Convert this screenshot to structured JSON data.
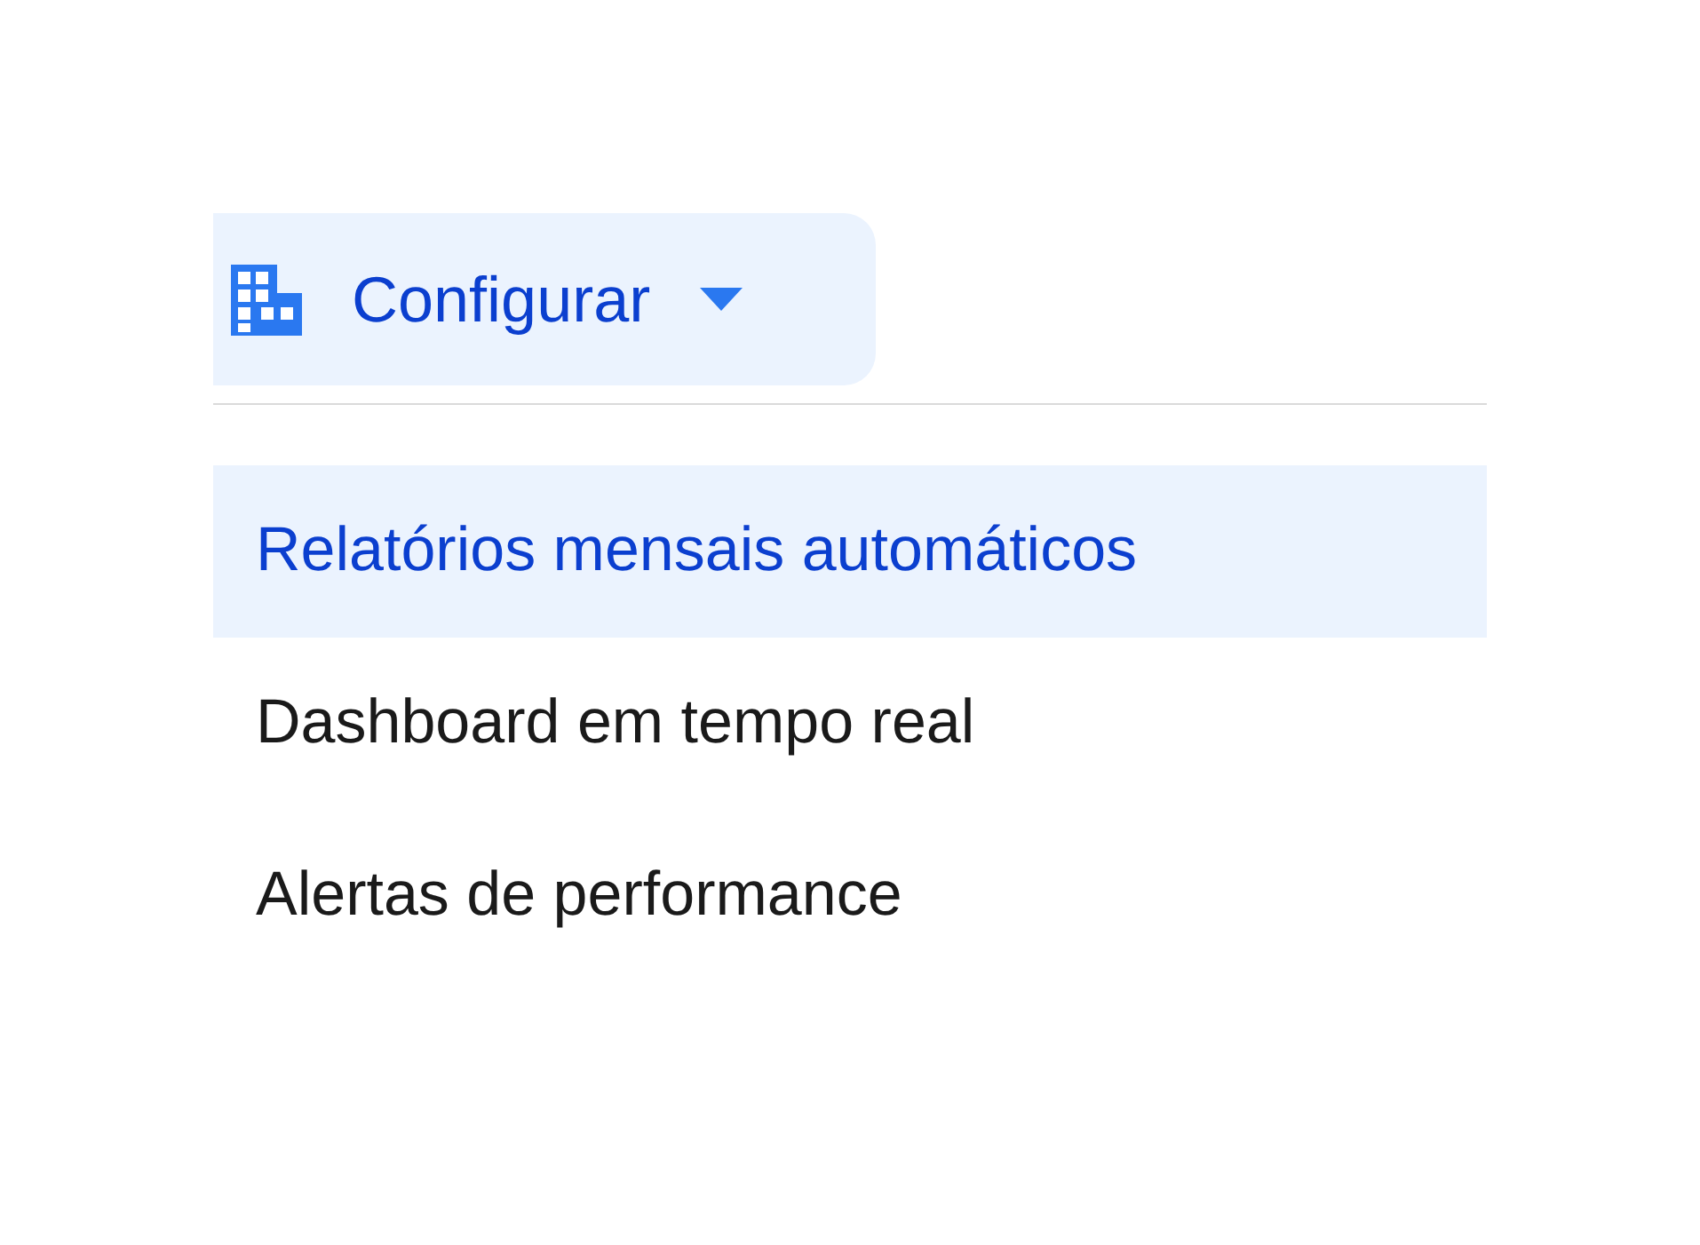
{
  "dropdown": {
    "label": "Configurar",
    "expanded": true
  },
  "menu_items": [
    {
      "label": "Relatórios mensais automáticos",
      "selected": true
    },
    {
      "label": "Dashboard em tempo real",
      "selected": false
    },
    {
      "label": "Alertas de performance",
      "selected": false
    }
  ]
}
